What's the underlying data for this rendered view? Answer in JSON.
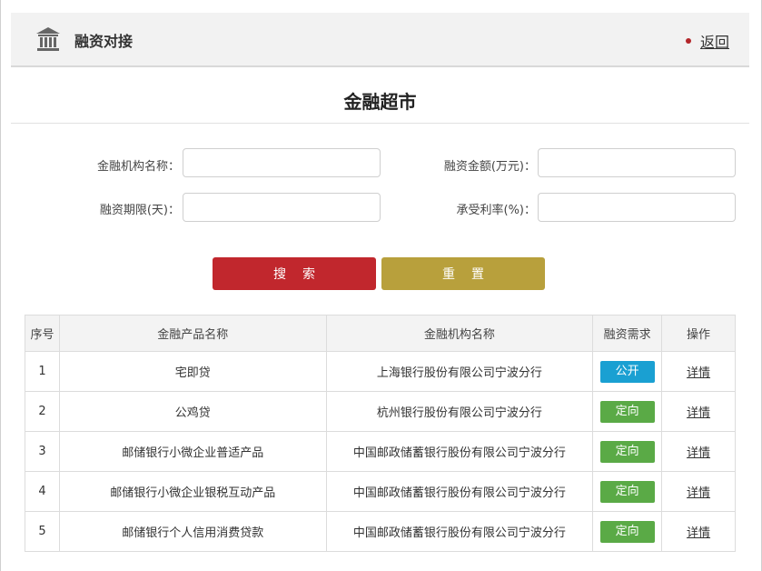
{
  "header": {
    "title": "融资对接",
    "back_label": "返回",
    "icon": "bank-icon"
  },
  "page": {
    "title": "金融超市"
  },
  "form": {
    "institution_label": "金融机构名称：",
    "amount_label": "融资金额(万元)：",
    "term_label": "融资期限(天)：",
    "rate_label": "承受利率(%)：",
    "institution_value": "",
    "amount_value": "",
    "term_value": "",
    "rate_value": ""
  },
  "buttons": {
    "search_label": "搜索",
    "reset_label": "重置"
  },
  "table": {
    "headers": [
      "序号",
      "金融产品名称",
      "金融机构名称",
      "融资需求",
      "操作"
    ],
    "rows": [
      {
        "index": "1",
        "product": "宅即贷",
        "institution": "上海银行股份有限公司宁波分行",
        "demand": "公开",
        "demand_type": "open",
        "action": "详情"
      },
      {
        "index": "2",
        "product": "公鸡贷",
        "institution": "杭州银行股份有限公司宁波分行",
        "demand": "定向",
        "demand_type": "directed",
        "action": "详情"
      },
      {
        "index": "3",
        "product": "邮储银行小微企业普适产品",
        "institution": "中国邮政储蓄银行股份有限公司宁波分行",
        "demand": "定向",
        "demand_type": "directed",
        "action": "详情"
      },
      {
        "index": "4",
        "product": "邮储银行小微企业银税互动产品",
        "institution": "中国邮政储蓄银行股份有限公司宁波分行",
        "demand": "定向",
        "demand_type": "directed",
        "action": "详情"
      },
      {
        "index": "5",
        "product": "邮储银行个人信用消费贷款",
        "institution": "中国邮政储蓄银行股份有限公司宁波分行",
        "demand": "定向",
        "demand_type": "directed",
        "action": "详情"
      }
    ]
  },
  "colors": {
    "accent_red": "#c1272d",
    "reset_gold": "#b8a03c",
    "tag_open": "#1aa0d2",
    "tag_directed": "#5aaa46"
  }
}
